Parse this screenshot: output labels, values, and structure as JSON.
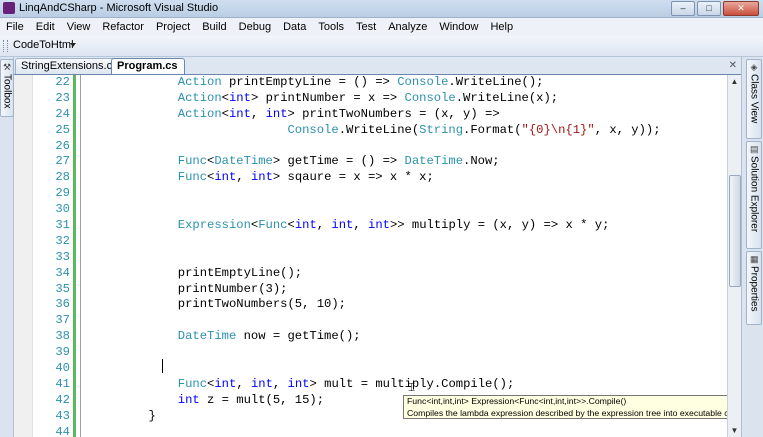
{
  "window": {
    "title": "LinqAndCSharp - Microsoft Visual Studio",
    "buttons": {
      "minimize": "–",
      "maximize": "□",
      "close": "✕"
    }
  },
  "menu": [
    "File",
    "Edit",
    "View",
    "Refactor",
    "Project",
    "Build",
    "Debug",
    "Data",
    "Tools",
    "Test",
    "Analyze",
    "Window",
    "Help"
  ],
  "toolbar": {
    "button_label": "CodeToHtml"
  },
  "left_panel": {
    "toolbox_label": "Toolbox"
  },
  "right_panel": {
    "tabs": [
      "Class View",
      "Solution Explorer",
      "Properties"
    ]
  },
  "tabs": [
    {
      "label": "StringExtensions.cs",
      "active": false
    },
    {
      "label": "Program.cs",
      "active": true
    }
  ],
  "tab_close_glyph": "✕",
  "code_lines": [
    {
      "num": "22",
      "segments": [
        [
          "            ",
          "p"
        ],
        [
          "Action",
          "t"
        ],
        [
          " printEmptyLine = () => ",
          "p"
        ],
        [
          "Console",
          "t"
        ],
        [
          ".WriteLine();",
          "p"
        ]
      ]
    },
    {
      "num": "23",
      "segments": [
        [
          "            ",
          "p"
        ],
        [
          "Action",
          "t"
        ],
        [
          "<",
          "p"
        ],
        [
          "int",
          "k"
        ],
        [
          "> printNumber = x => ",
          "p"
        ],
        [
          "Console",
          "t"
        ],
        [
          ".WriteLine(x);",
          "p"
        ]
      ]
    },
    {
      "num": "24",
      "segments": [
        [
          "            ",
          "p"
        ],
        [
          "Action",
          "t"
        ],
        [
          "<",
          "p"
        ],
        [
          "int",
          "k"
        ],
        [
          ", ",
          "p"
        ],
        [
          "int",
          "k"
        ],
        [
          "> printTwoNumbers = (x, y) =>",
          "p"
        ]
      ]
    },
    {
      "num": "25",
      "segments": [
        [
          "                           ",
          "p"
        ],
        [
          "Console",
          "t"
        ],
        [
          ".WriteLine(",
          "p"
        ],
        [
          "String",
          "t"
        ],
        [
          ".Format(",
          "p"
        ],
        [
          "\"{0}\\n{1}\"",
          "s"
        ],
        [
          ", x, y));",
          "p"
        ]
      ]
    },
    {
      "num": "26",
      "segments": []
    },
    {
      "num": "27",
      "segments": [
        [
          "            ",
          "p"
        ],
        [
          "Func",
          "t"
        ],
        [
          "<",
          "p"
        ],
        [
          "DateTime",
          "t"
        ],
        [
          "> getTime = () => ",
          "p"
        ],
        [
          "DateTime",
          "t"
        ],
        [
          ".Now;",
          "p"
        ]
      ]
    },
    {
      "num": "28",
      "segments": [
        [
          "            ",
          "p"
        ],
        [
          "Func",
          "t"
        ],
        [
          "<",
          "p"
        ],
        [
          "int",
          "k"
        ],
        [
          ", ",
          "p"
        ],
        [
          "int",
          "k"
        ],
        [
          "> sqaure = x => x * x;",
          "p"
        ]
      ]
    },
    {
      "num": "29",
      "segments": []
    },
    {
      "num": "30",
      "segments": []
    },
    {
      "num": "31",
      "segments": [
        [
          "            ",
          "p"
        ],
        [
          "Expression",
          "t"
        ],
        [
          "<",
          "p"
        ],
        [
          "Func",
          "t"
        ],
        [
          "<",
          "p"
        ],
        [
          "int",
          "k"
        ],
        [
          ", ",
          "p"
        ],
        [
          "int",
          "k"
        ],
        [
          ", ",
          "p"
        ],
        [
          "int",
          "k"
        ],
        [
          ">> multiply = (x, y) => x * y;",
          "p"
        ]
      ]
    },
    {
      "num": "32",
      "segments": []
    },
    {
      "num": "33",
      "segments": []
    },
    {
      "num": "34",
      "segments": [
        [
          "            printEmptyLine();",
          "p"
        ]
      ]
    },
    {
      "num": "35",
      "segments": [
        [
          "            printNumber(3);",
          "p"
        ]
      ]
    },
    {
      "num": "36",
      "segments": [
        [
          "            printTwoNumbers(5, 10);",
          "p"
        ]
      ]
    },
    {
      "num": "37",
      "segments": []
    },
    {
      "num": "38",
      "segments": [
        [
          "            ",
          "p"
        ],
        [
          "DateTime",
          "t"
        ],
        [
          " now = getTime();",
          "p"
        ]
      ]
    },
    {
      "num": "39",
      "segments": []
    },
    {
      "num": "40",
      "segments": []
    },
    {
      "num": "41",
      "segments": [
        [
          "            ",
          "p"
        ],
        [
          "Func",
          "t"
        ],
        [
          "<",
          "p"
        ],
        [
          "int",
          "k"
        ],
        [
          ", ",
          "p"
        ],
        [
          "int",
          "k"
        ],
        [
          ", ",
          "p"
        ],
        [
          "int",
          "k"
        ],
        [
          "> mult = multiply.Compile();",
          "p"
        ]
      ]
    },
    {
      "num": "42",
      "segments": [
        [
          "            ",
          "p"
        ],
        [
          "int",
          "k"
        ],
        [
          " z = mult(5, 15);",
          "p"
        ]
      ]
    },
    {
      "num": "43",
      "segments": [
        [
          "        }",
          "p"
        ]
      ]
    },
    {
      "num": "44",
      "segments": []
    }
  ],
  "tooltip": {
    "signature": "Func<int,int,int> Expression<Func<int,int,int>>.Compile()",
    "description": "Compiles the lambda expression described by the expression tree into executable code."
  },
  "colors": {
    "type": "#2b91af",
    "keyword": "#0000ff",
    "string": "#a31515",
    "change_bar": "#5cb85c"
  }
}
